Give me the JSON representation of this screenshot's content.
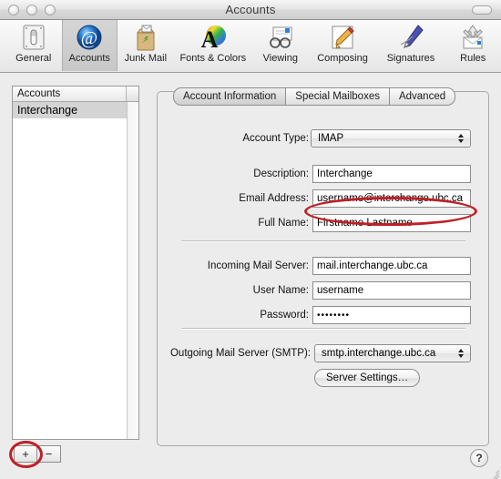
{
  "window": {
    "title": "Accounts",
    "traffic_lights": [
      "close",
      "minimize",
      "zoom"
    ]
  },
  "toolbar": {
    "items": [
      {
        "label": "General",
        "icon": "general-icon",
        "selected": false
      },
      {
        "label": "Accounts",
        "icon": "accounts-at-icon",
        "selected": true
      },
      {
        "label": "Junk Mail",
        "icon": "junk-mail-bag-icon",
        "selected": false
      },
      {
        "label": "Fonts & Colors",
        "icon": "fonts-colors-icon",
        "selected": false
      },
      {
        "label": "Viewing",
        "icon": "viewing-glasses-icon",
        "selected": false
      },
      {
        "label": "Composing",
        "icon": "composing-pencil-icon",
        "selected": false
      },
      {
        "label": "Signatures",
        "icon": "signatures-pen-icon",
        "selected": false
      },
      {
        "label": "Rules",
        "icon": "rules-envelope-icon",
        "selected": false
      }
    ]
  },
  "accounts_list": {
    "header": "Accounts",
    "rows": [
      {
        "label": "Interchange",
        "selected": true
      }
    ],
    "add_button": "+",
    "remove_button": "−"
  },
  "tabs": [
    {
      "label": "Account Information",
      "selected": true
    },
    {
      "label": "Special Mailboxes",
      "selected": false
    },
    {
      "label": "Advanced",
      "selected": false
    }
  ],
  "form": {
    "account_type": {
      "label": "Account Type:",
      "value": "IMAP"
    },
    "description": {
      "label": "Description:",
      "value": "Interchange"
    },
    "email_address": {
      "label": "Email Address:",
      "value": "username@interchange.ubc.ca"
    },
    "full_name": {
      "label": "Full Name:",
      "value": "Firstname Lastname"
    },
    "incoming_mail_server": {
      "label": "Incoming Mail Server:",
      "value": "mail.interchange.ubc.ca"
    },
    "user_name": {
      "label": "User Name:",
      "value": "username"
    },
    "password": {
      "label": "Password:",
      "value": "••••••••"
    },
    "outgoing_mail_server": {
      "label": "Outgoing Mail Server (SMTP):",
      "value": "smtp.interchange.ubc.ca"
    },
    "server_settings_button": "Server Settings…"
  },
  "footer": {
    "help_button": "?"
  },
  "annotations": {
    "color": "#bf2026",
    "shapes": [
      {
        "target": "account-type-popup",
        "shape": "ellipse"
      },
      {
        "target": "add-account-button",
        "shape": "circle"
      }
    ]
  }
}
